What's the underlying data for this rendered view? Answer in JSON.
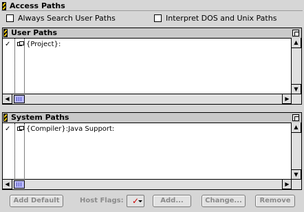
{
  "group": {
    "title": "Access Paths"
  },
  "options": {
    "always_search": {
      "label": "Always Search User Paths",
      "checked": false
    },
    "interpret_paths": {
      "label": "Interpret DOS and Unix Paths",
      "checked": false
    }
  },
  "user_paths": {
    "title": "User Paths",
    "rows": [
      {
        "checked": true,
        "path": "{Project}:"
      }
    ]
  },
  "system_paths": {
    "title": "System Paths",
    "rows": [
      {
        "checked": true,
        "path": "{Compiler}:Java Support:"
      }
    ]
  },
  "bottom": {
    "add_default": "Add Default",
    "host_flags_label": "Host Flags:",
    "add": "Add...",
    "change": "Change...",
    "remove": "Remove"
  },
  "icons": {
    "stripe": "header-stripe-icon",
    "zoom": "zoom-box-icon",
    "folder": "folder-icon",
    "check": "✓"
  }
}
